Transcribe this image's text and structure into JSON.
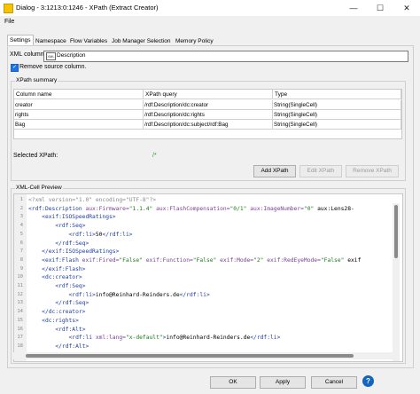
{
  "window": {
    "title": "Dialog - 3:1213:0:1246 - XPath (Extract Creator)",
    "controls": {
      "minimize": "—",
      "maximize": "☐",
      "close": "✕"
    }
  },
  "menu": {
    "file": "File"
  },
  "tabs": [
    "Settings",
    "Namespace",
    "Flow Variables",
    "Job Manager Selection",
    "Memory Policy"
  ],
  "settings": {
    "xml_column_label": "XML column:",
    "xml_badge": "XML",
    "xml_column_value": "Description",
    "remove_source_label": "Remove source column.",
    "xpath_summary_title": "XPath summary",
    "columns": [
      "Column name",
      "XPath query",
      "Type"
    ],
    "rows": [
      [
        "creator",
        "/rdf:Description/dc:creator",
        "String(SingleCell)"
      ],
      [
        "rights",
        "/rdf:Description/dc:rights",
        "String(SingleCell)"
      ],
      [
        "Bag",
        "/rdf:Description/dc:subject/rdf:Bag",
        "String(SingleCell)"
      ]
    ],
    "selected_xpath_label": "Selected XPath:",
    "selected_xpath_value": "/*",
    "add_label": "Add XPath",
    "edit_label": "Edit XPath",
    "remove_label": "Remove XPath",
    "xml_preview_title": "XML-Cell Preview"
  },
  "preview_lines": [
    "<?xml version=\"1.0\" encoding=\"UTF-8\"?>",
    "<rdf:Description aux:Firmware=\"1.1.4\" aux:FlashCompensation=\"0/1\" aux:ImageNumber=\"0\" aux:Lens=\"28-",
    "    <exif:ISOSpeedRatings>",
    "        <rdf:Seq>",
    "            <rdf:li>50</rdf:li>",
    "        </rdf:Seq>",
    "    </exif:ISOSpeedRatings>",
    "    <exif:Flash exif:Fired=\"False\" exif:Function=\"False\" exif:Mode=\"2\" exif:RedEyeMode=\"False\" exif",
    "    </exif:Flash>",
    "    <dc:creator>",
    "        <rdf:Seq>",
    "            <rdf:li>info@Reinhard-Reinders.de</rdf:li>",
    "        </rdf:Seq>",
    "    </dc:creator>",
    "    <dc:rights>",
    "        <rdf:Alt>",
    "            <rdf:li xml:lang=\"x-default\">info@Reinhard-Reinders.de</rdf:li>",
    "        </rdf:Alt>"
  ],
  "footer": {
    "ok": "OK",
    "apply": "Apply",
    "cancel": "Cancel",
    "help_glyph": "?"
  }
}
